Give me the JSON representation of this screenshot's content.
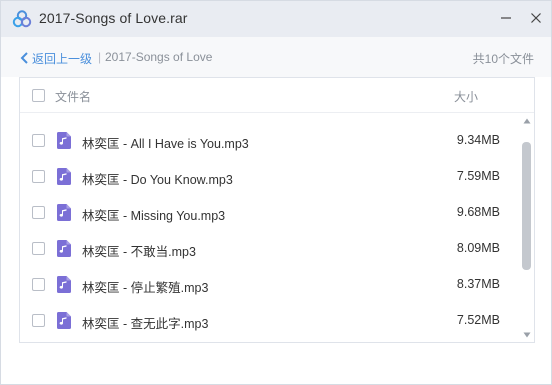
{
  "window": {
    "title": "2017-Songs of Love.rar",
    "app_icon": "cloud-rings-icon",
    "minimize_icon": "minimize-icon",
    "close_icon": "close-icon"
  },
  "toolbar": {
    "back_label": "返回上一级",
    "separator": "|",
    "current_folder": "2017-Songs of Love",
    "file_count": "共10个文件"
  },
  "list": {
    "header": {
      "name": "文件名",
      "size": "大小"
    },
    "rows": [
      {
        "name": "林奕匡 - All I Have is You.mp3",
        "size": "9.34MB",
        "icon": "music-file-icon"
      },
      {
        "name": "林奕匡 - Do You Know.mp3",
        "size": "7.59MB",
        "icon": "music-file-icon"
      },
      {
        "name": "林奕匡 - Missing You.mp3",
        "size": "9.68MB",
        "icon": "music-file-icon"
      },
      {
        "name": "林奕匡 - 不敢当.mp3",
        "size": "8.09MB",
        "icon": "music-file-icon"
      },
      {
        "name": "林奕匡 - 停止繁殖.mp3",
        "size": "8.37MB",
        "icon": "music-file-icon"
      },
      {
        "name": "林奕匡 - 查无此字.mp3",
        "size": "7.52MB",
        "icon": "music-file-icon"
      }
    ]
  },
  "colors": {
    "accent": "#4a8fdc",
    "music_icon": "#7b6fd6",
    "titlebar_bg": "#e9ecf2"
  }
}
